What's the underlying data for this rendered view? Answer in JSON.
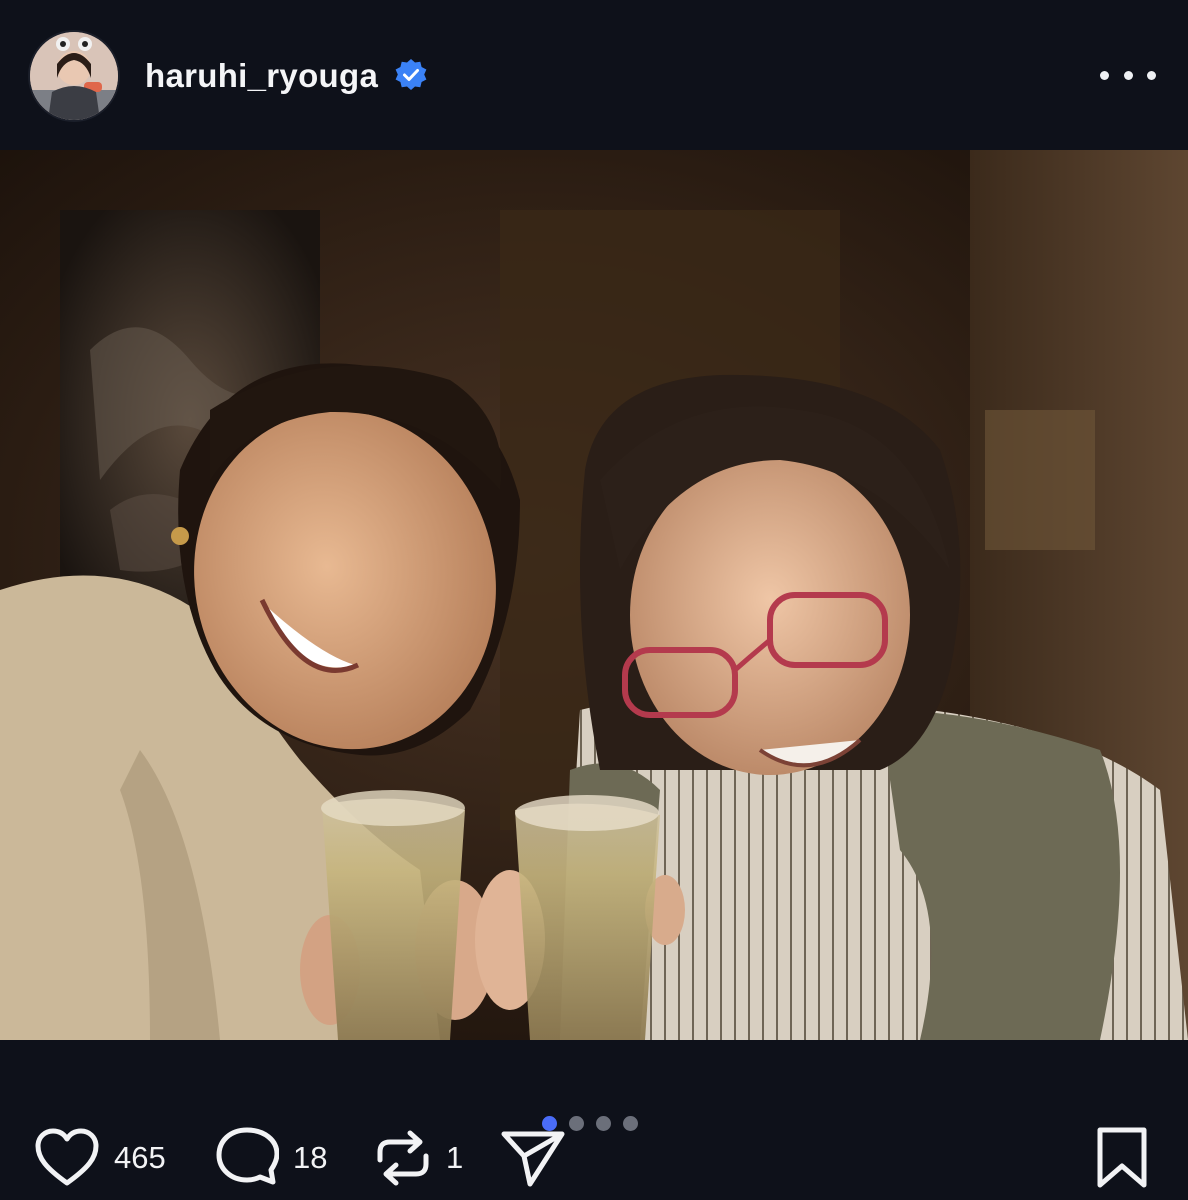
{
  "post": {
    "username": "haruhi_ryouga",
    "verified": true,
    "more_icon": "more-horizontal-icon"
  },
  "carousel": {
    "total_slides": 4,
    "active_index": 0
  },
  "actions": {
    "likes": "465",
    "comments": "18",
    "reposts": "1"
  },
  "colors": {
    "background": "#0e111a",
    "verified_badge": "#3b82f6",
    "active_dot": "#4a6cf7",
    "inactive_dot": "#6b6f7a"
  }
}
